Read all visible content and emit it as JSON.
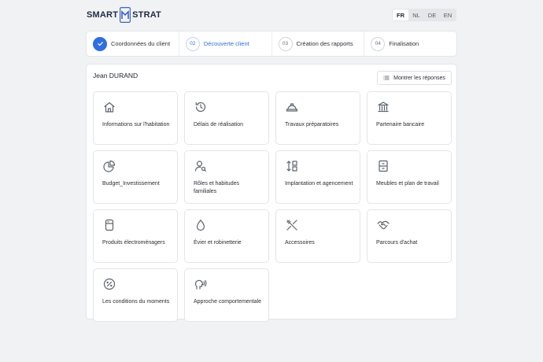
{
  "header": {
    "logo_left": "SMART",
    "logo_right": "STRAT",
    "languages": [
      "FR",
      "NL",
      "DE",
      "EN"
    ],
    "active_language": "FR"
  },
  "stepper": {
    "steps": [
      {
        "num": "",
        "label": "Coordonnées du client",
        "state": "done"
      },
      {
        "num": "02",
        "label": "Découverte client",
        "state": "active"
      },
      {
        "num": "03",
        "label": "Création des rapports",
        "state": "todo"
      },
      {
        "num": "04",
        "label": "Finalisation",
        "state": "todo"
      }
    ]
  },
  "main": {
    "client_name": "Jean DURAND",
    "show_answers_label": "Montrer les réponses",
    "cards": [
      {
        "label": "Informations sur l'habitation",
        "icon": "home-icon"
      },
      {
        "label": "Délais de réalisation",
        "icon": "history-icon"
      },
      {
        "label": "Travaux préparatoires",
        "icon": "hard-hat-icon"
      },
      {
        "label": "Partenaire bancaire",
        "icon": "bank-icon"
      },
      {
        "label": "Budget_Investissement",
        "icon": "pie-chart-icon"
      },
      {
        "label": "Rôles et habitudes familiales",
        "icon": "user-search-icon"
      },
      {
        "label": "Implantation et agencement",
        "icon": "layout-arrows-icon"
      },
      {
        "label": "Meubles et plan de travail",
        "icon": "cabinet-icon"
      },
      {
        "label": "Produits électroménagers",
        "icon": "appliance-icon"
      },
      {
        "label": "Évier et robinetterie",
        "icon": "water-drop-icon"
      },
      {
        "label": "Accessoires",
        "icon": "utensils-crossed-icon"
      },
      {
        "label": "Parcours d'achat",
        "icon": "handshake-icon"
      },
      {
        "label": "Les conditions du moments",
        "icon": "gauge-icon"
      },
      {
        "label": "Approche comportementale",
        "icon": "speaking-head-icon"
      }
    ]
  },
  "colors": {
    "accent": "#2f6fe0",
    "background": "#f1f2f4",
    "logo": "#1f2a44"
  }
}
